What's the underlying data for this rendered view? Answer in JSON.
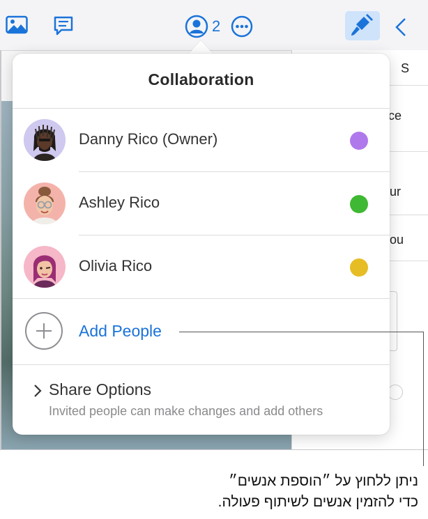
{
  "toolbar": {
    "collaborator_count": "2",
    "icons": [
      "photo-icon",
      "comment-icon",
      "collaborate-icon",
      "more-icon",
      "format-brush-icon",
      "chevron-left-icon"
    ],
    "accent_color": "#1a73d9"
  },
  "side_panel": {
    "fragments": [
      "S",
      "ce",
      "ur",
      "ou"
    ]
  },
  "popover": {
    "title": "Collaboration",
    "people": [
      {
        "name": "Danny Rico (Owner)",
        "avatar": "danny-avatar",
        "dot_color": "#af79ec"
      },
      {
        "name": "Ashley Rico",
        "avatar": "ashley-avatar",
        "dot_color": "#3fb833"
      },
      {
        "name": "Olivia Rico",
        "avatar": "olivia-avatar",
        "dot_color": "#e6bd24"
      }
    ],
    "add_people_label": "Add People",
    "share_options_title": "Share Options",
    "share_options_subtitle": "Invited people can make changes and add others"
  },
  "callout": {
    "line1": "ניתן ללחוץ על ״הוספת אנשים״",
    "line2": "כדי להזמין אנשים לשיתוף פעולה."
  }
}
